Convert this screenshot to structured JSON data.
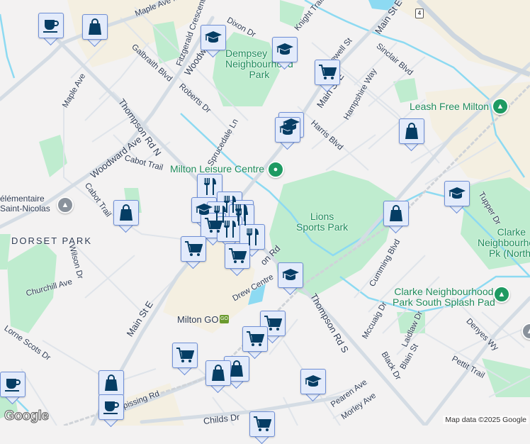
{
  "map": {
    "colors": {
      "background": "#f3f2f2",
      "park": "#bfeccf",
      "commercial": "#f4efe1",
      "road": "#d4dce4",
      "water": "#8ddaf2",
      "marker_fill": "#e3ebfb",
      "marker_icon": "#053d64",
      "poi_text": "#1e8a5a"
    },
    "highway_shield": "4",
    "area_labels": [
      "DORSET PARK"
    ],
    "poi_labels": {
      "dempsey": [
        "Dempsey",
        "Neighbourhood",
        "Park"
      ],
      "leisure": "Milton Leisure Centre",
      "leash": "Leash Free Milton",
      "lions": [
        "Lions",
        "Sports Park"
      ],
      "clarke_north": [
        "Clarke",
        "Neighbourhood",
        "Pk (North)"
      ],
      "clarke_south": [
        "Clarke Neighbourhood",
        "Park South Splash Pad"
      ],
      "school": [
        "élémentaire",
        "Saint-Nicolas"
      ],
      "go": "Milton GO",
      "go_badge": "GO"
    },
    "streets": {
      "maple_top": "Maple Ave  Maple",
      "fitzgerald": "Fitzgerald Crescent",
      "dixon": "Dixon Dr",
      "knight": "Knight Trail",
      "newell": "Newell St",
      "main_n": "Main St E",
      "main_mid": "Main St E",
      "main_s": "Main St E",
      "sinclair": "Sinclair Blvd",
      "galbraith": "Galbraith Blvd",
      "woodward_n": "Woodward",
      "hampshire": "Hampshire Way",
      "maple": "Maple Ave",
      "thompson_n": "Thompson Rd N",
      "roberts": "Roberts Dr",
      "harris": "Harris Blvd",
      "sprucedale": "Sprucedale Ln",
      "woodward": "Woodward Ave",
      "cabot1": "Cabot Trail",
      "cabot2": "Cabot Trail",
      "tupper": "Tupper Dr",
      "wilson": "Wilson Dr",
      "cumming": "Cumming Blvd",
      "churchill": "Churchill Ave",
      "drew": "Drew Centre",
      "thompson_s": "Thompson Rd S",
      "mccuaig": "Mccuaig Dr",
      "laidlaw": "Laidlaw Dr",
      "denyes": "Denyes Wy",
      "lorne": "Lorne Scots Dr",
      "blain": "Blain St",
      "black": "Black Dr",
      "pettit": "Pettit Trail",
      "pearen": "Pearen Ave",
      "morley": "Morley Ave",
      "nipissing": "Nipissing Rd",
      "childs": "Childs Dr",
      "sdr": "on Rd"
    },
    "markers": [
      {
        "type": "coffee"
      },
      {
        "type": "shopping"
      },
      {
        "type": "school"
      },
      {
        "type": "school"
      },
      {
        "type": "grocery"
      },
      {
        "type": "school"
      },
      {
        "type": "school"
      },
      {
        "type": "shopping"
      },
      {
        "type": "school"
      },
      {
        "type": "shopping"
      },
      {
        "type": "shopping"
      },
      {
        "type": "restaurant"
      },
      {
        "type": "restaurant"
      },
      {
        "type": "restaurant"
      },
      {
        "type": "school"
      },
      {
        "type": "restaurant"
      },
      {
        "type": "restaurant"
      },
      {
        "type": "grocery"
      },
      {
        "type": "restaurant"
      },
      {
        "type": "restaurant"
      },
      {
        "type": "grocery"
      },
      {
        "type": "grocery"
      },
      {
        "type": "school"
      },
      {
        "type": "grocery"
      },
      {
        "type": "grocery"
      },
      {
        "type": "grocery"
      },
      {
        "type": "shopping"
      },
      {
        "type": "shopping"
      },
      {
        "type": "shopping"
      },
      {
        "type": "coffee"
      },
      {
        "type": "coffee"
      },
      {
        "type": "grocery"
      },
      {
        "type": "school"
      }
    ],
    "logo": "Google",
    "attribution": "Map data ©2025 Google"
  }
}
